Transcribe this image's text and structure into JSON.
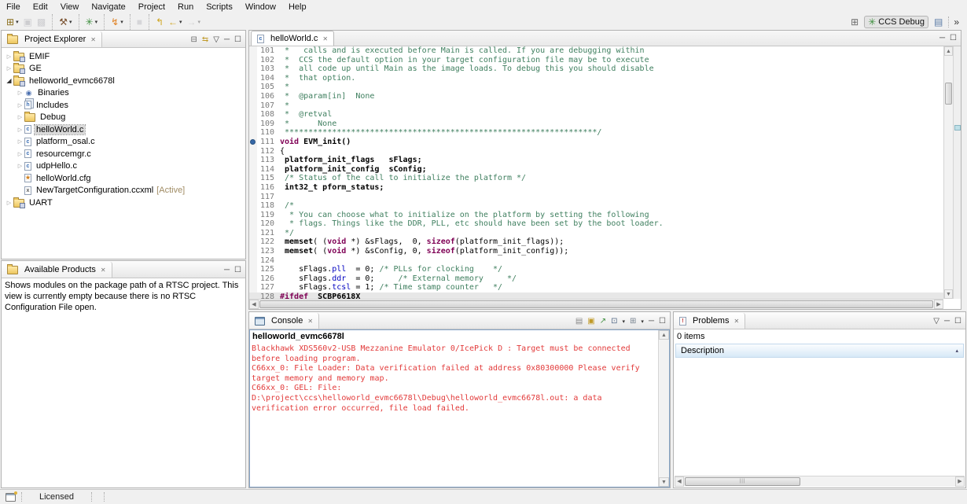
{
  "icons": {
    "close": "✕",
    "view_menu": "▽",
    "minimize": "─",
    "maximize": "☐",
    "scroll_up": "▲",
    "scroll_down": "▼",
    "scroll_left": "◀",
    "scroll_right": "▶",
    "sort_asc": "▴",
    "dropdown": "▾",
    "overflow": "»"
  },
  "menu_bar": {
    "items": [
      "File",
      "Edit",
      "View",
      "Navigate",
      "Project",
      "Run",
      "Scripts",
      "Window",
      "Help"
    ]
  },
  "toolbar": {
    "groups": [
      {
        "buttons": [
          {
            "name": "new",
            "glyph": "⊞",
            "color": "#8a6d1a",
            "dropdown": true
          },
          {
            "name": "save",
            "glyph": "▣",
            "color": "#9a9aa2",
            "disabled": true
          },
          {
            "name": "save-all",
            "glyph": "▩",
            "color": "#9a9aa2",
            "disabled": true
          }
        ]
      },
      {
        "buttons": [
          {
            "name": "build",
            "glyph": "⚒",
            "color": "#7a5230",
            "dropdown": true
          }
        ]
      },
      {
        "buttons": [
          {
            "name": "debug",
            "glyph": "✳",
            "color": "#3f8f3f",
            "dropdown": true
          }
        ]
      },
      {
        "buttons": [
          {
            "name": "flash",
            "glyph": "↯",
            "color": "#e08020",
            "dropdown": true
          }
        ]
      },
      {
        "buttons": [
          {
            "name": "terminate",
            "glyph": "■",
            "color": "#b0b0b8",
            "disabled": true
          }
        ]
      },
      {
        "buttons": [
          {
            "name": "last-edit-location",
            "glyph": "↰",
            "color": "#cfa520"
          },
          {
            "name": "back",
            "glyph": "←",
            "color": "#cfa520",
            "dropdown": true
          },
          {
            "name": "forward",
            "glyph": "→",
            "color": "#a8a8a8",
            "dropdown": true,
            "disabled": true
          }
        ]
      }
    ]
  },
  "perspective_bar": {
    "buttons": [
      {
        "name": "open-perspective",
        "glyph": "⊞",
        "color": "#6b6b6b"
      },
      {
        "name": "ccs-debug-perspective",
        "glyph": "✳",
        "color": "#3f8f3f",
        "label": "CCS Debug",
        "pressed": true
      },
      {
        "name": "ccs-edit-perspective",
        "glyph": "▤",
        "color": "#5a7ba6"
      },
      {
        "name": "perspective-overflow",
        "glyph": "»",
        "color": "#333333",
        "separator_before": true
      }
    ]
  },
  "project_explorer": {
    "title": "Project Explorer",
    "actions": [
      {
        "name": "collapse-all",
        "glyph": "⊟",
        "color": "#666666"
      },
      {
        "name": "link-with-editor",
        "glyph": "⇆",
        "color": "#c09a28"
      },
      {
        "name": "view-menu",
        "glyph": "▽",
        "color": "#444444"
      },
      {
        "name": "minimize",
        "glyph": "─",
        "color": "#444444"
      },
      {
        "name": "maximize",
        "glyph": "☐",
        "color": "#444444"
      }
    ],
    "items": [
      {
        "label": "EMIF",
        "indent": 0,
        "expander": "collapsed",
        "icon": "ccs-project",
        "icon_class": "fi-folder fi-proj"
      },
      {
        "label": "GE",
        "indent": 0,
        "expander": "collapsed",
        "icon": "ccs-project",
        "icon_class": "fi-folder fi-proj"
      },
      {
        "label": "helloworld_evmc6678l",
        "indent": 0,
        "expander": "expanded",
        "icon": "ccs-project-open",
        "icon_class": "fi-folder fi-proj"
      },
      {
        "label": "Binaries",
        "indent": 1,
        "expander": "collapsed",
        "icon": "binaries",
        "icon_class": "fi-glyph",
        "icon_letter": "◉",
        "icon_letter_color": "#4a6faf"
      },
      {
        "label": "Includes",
        "indent": 1,
        "expander": "collapsed",
        "icon": "includes",
        "icon_class": "fi-page fi-inc",
        "icon_letter": "h",
        "icon_letter_color": "#3a6eb5"
      },
      {
        "label": "Debug",
        "indent": 1,
        "expander": "collapsed",
        "icon": "folder",
        "icon_class": "fi-folder"
      },
      {
        "label": "helloWorld.c",
        "indent": 1,
        "expander": "collapsed",
        "icon": "c-file",
        "icon_class": "fi-page",
        "icon_letter": "c",
        "icon_letter_color": "#3a6eb5",
        "selected": true
      },
      {
        "label": "platform_osal.c",
        "indent": 1,
        "expander": "collapsed",
        "icon": "c-file",
        "icon_class": "fi-page",
        "icon_letter": "c",
        "icon_letter_color": "#3a6eb5"
      },
      {
        "label": "resourcemgr.c",
        "indent": 1,
        "expander": "collapsed",
        "icon": "c-file-linked",
        "icon_class": "fi-page",
        "icon_letter": "c",
        "icon_letter_color": "#3a6eb5"
      },
      {
        "label": "udpHello.c",
        "indent": 1,
        "expander": "collapsed",
        "icon": "c-file",
        "icon_class": "fi-page",
        "icon_letter": "c",
        "icon_letter_color": "#3a6eb5"
      },
      {
        "label": "helloWorld.cfg",
        "indent": 1,
        "expander": "none",
        "icon": "rtsc-cfg-file",
        "icon_class": "fi-page",
        "icon_letter": "★",
        "icon_letter_color": "#d08020"
      },
      {
        "label": "NewTargetConfiguration.ccxml",
        "indent": 1,
        "expander": "none",
        "icon": "ccxml-file",
        "icon_class": "fi-page",
        "icon_letter": "x",
        "icon_letter_color": "#555555",
        "suffix": "[Active]"
      },
      {
        "label": "UART",
        "indent": 0,
        "expander": "collapsed",
        "icon": "ccs-project",
        "icon_class": "fi-folder fi-proj"
      }
    ]
  },
  "available_products": {
    "title": "Available Products",
    "message": "Shows modules on the package path of a RTSC project. This view is currently empty because there is no RTSC Configuration File open.",
    "actions": [
      {
        "name": "minimize",
        "glyph": "─",
        "color": "#444444"
      },
      {
        "name": "maximize",
        "glyph": "☐",
        "color": "#444444"
      }
    ]
  },
  "editor": {
    "tab_label": "helloWorld.c",
    "actions": [
      {
        "name": "minimize",
        "glyph": "─",
        "color": "#444444"
      },
      {
        "name": "maximize",
        "glyph": "☐",
        "color": "#444444"
      }
    ],
    "lines": [
      {
        "num": 101,
        "seg": [
          {
            "c": "cm",
            "t": " *   calls and is executed before Main is called. If you are debugging within"
          }
        ]
      },
      {
        "num": 102,
        "seg": [
          {
            "c": "cm",
            "t": " *  CCS the default option in your target configuration file may be to execute"
          }
        ]
      },
      {
        "num": 103,
        "seg": [
          {
            "c": "cm",
            "t": " *  all code up until Main as the image loads. To debug this you should disable"
          }
        ]
      },
      {
        "num": 104,
        "seg": [
          {
            "c": "cm",
            "t": " *  that option."
          }
        ]
      },
      {
        "num": 105,
        "seg": [
          {
            "c": "cm",
            "t": " *"
          }
        ]
      },
      {
        "num": 106,
        "seg": [
          {
            "c": "cm",
            "t": " *  @param[in]  None"
          }
        ]
      },
      {
        "num": 107,
        "seg": [
          {
            "c": "cm",
            "t": " *"
          }
        ]
      },
      {
        "num": 108,
        "seg": [
          {
            "c": "cm",
            "t": " *  @retval"
          }
        ]
      },
      {
        "num": 109,
        "seg": [
          {
            "c": "cm",
            "t": " *      None"
          }
        ]
      },
      {
        "num": 110,
        "seg": [
          {
            "c": "cm",
            "t": " ******************************************************************/"
          }
        ]
      },
      {
        "num": 111,
        "breakpoint": true,
        "seg": [
          {
            "c": "kw",
            "t": "void"
          },
          {
            "c": "fn",
            "t": " EVM_init()"
          }
        ]
      },
      {
        "num": 112,
        "seg": [
          {
            "c": "pl",
            "t": "{"
          }
        ]
      },
      {
        "num": 113,
        "seg": [
          {
            "c": "fn",
            "t": " platform_init_flags   sFlags;"
          }
        ]
      },
      {
        "num": 114,
        "seg": [
          {
            "c": "fn",
            "t": " platform_init_config  sConfig;"
          }
        ]
      },
      {
        "num": 115,
        "seg": [
          {
            "c": "cm",
            "t": " /* Status of the call to initialize the platform */"
          }
        ]
      },
      {
        "num": 116,
        "seg": [
          {
            "c": "fn",
            "t": " int32_t pform_status;"
          }
        ]
      },
      {
        "num": 117,
        "seg": []
      },
      {
        "num": 118,
        "seg": [
          {
            "c": "cm",
            "t": " /*"
          }
        ]
      },
      {
        "num": 119,
        "seg": [
          {
            "c": "cm",
            "t": "  * You can choose what to initialize on the platform by setting the following"
          }
        ]
      },
      {
        "num": 120,
        "seg": [
          {
            "c": "cm",
            "t": "  * flags. Things like the DDR, PLL, etc should have been set by the boot loader."
          }
        ]
      },
      {
        "num": 121,
        "seg": [
          {
            "c": "cm",
            "t": " */"
          }
        ]
      },
      {
        "num": 122,
        "seg": [
          {
            "c": "fn",
            "t": " memset"
          },
          {
            "c": "pl",
            "t": "( ("
          },
          {
            "c": "kw",
            "t": "void"
          },
          {
            "c": "pl",
            "t": " *) &sFlags,  0, "
          },
          {
            "c": "kw",
            "t": "sizeof"
          },
          {
            "c": "pl",
            "t": "(platform_init_flags));"
          }
        ]
      },
      {
        "num": 123,
        "seg": [
          {
            "c": "fn",
            "t": " memset"
          },
          {
            "c": "pl",
            "t": "( ("
          },
          {
            "c": "kw",
            "t": "void"
          },
          {
            "c": "pl",
            "t": " *) &sConfig, 0, "
          },
          {
            "c": "kw",
            "t": "sizeof"
          },
          {
            "c": "pl",
            "t": "(platform_init_config));"
          }
        ]
      },
      {
        "num": 124,
        "seg": []
      },
      {
        "num": 125,
        "seg": [
          {
            "c": "pl",
            "t": "    sFlags."
          },
          {
            "c": "fld",
            "t": "pll"
          },
          {
            "c": "pl",
            "t": "  = 0; "
          },
          {
            "c": "cm",
            "t": "/* PLLs for clocking    */"
          }
        ]
      },
      {
        "num": 126,
        "seg": [
          {
            "c": "pl",
            "t": "    sFlags."
          },
          {
            "c": "fld",
            "t": "ddr"
          },
          {
            "c": "pl",
            "t": "  = 0;     "
          },
          {
            "c": "cm",
            "t": "/* External memory     */"
          }
        ]
      },
      {
        "num": 127,
        "seg": [
          {
            "c": "pl",
            "t": "    sFlags."
          },
          {
            "c": "fld",
            "t": "tcsl"
          },
          {
            "c": "pl",
            "t": " = 1; "
          },
          {
            "c": "cm",
            "t": "/* Time stamp counter   */"
          }
        ]
      },
      {
        "num": 128,
        "inactive": true,
        "seg": [
          {
            "c": "dir",
            "t": "#ifdef"
          },
          {
            "c": "fn",
            "t": "  SCBP6618X"
          }
        ]
      }
    ]
  },
  "console": {
    "title": "Console",
    "program_label": "helloworld_evmc6678l",
    "actions": [
      {
        "name": "clear-console",
        "glyph": "▤",
        "color": "#8a8a8a"
      },
      {
        "name": "scroll-lock",
        "glyph": "▣",
        "color": "#c09a28"
      },
      {
        "name": "pin-console",
        "glyph": "↗",
        "color": "#3f8f3f"
      },
      {
        "name": "display-selected-console",
        "glyph": "⊡",
        "color": "#556b88",
        "dropdown": true
      },
      {
        "name": "open-console",
        "glyph": "⊞",
        "color": "#77838f",
        "dropdown": true
      },
      {
        "name": "minimize",
        "glyph": "─",
        "color": "#444444"
      },
      {
        "name": "maximize",
        "glyph": "☐",
        "color": "#444444"
      }
    ],
    "lines": [
      "Blackhawk XDS560v2-USB Mezzanine Emulator 0/IcePick D : Target must be connected before loading program.",
      "C66xx_0: File Loader: Data verification failed at address 0x80300000 Please verify target memory and memory map.",
      "C66xx_0: GEL: File: D:\\project\\ccs\\helloworld_evmc6678l\\Debug\\helloworld_evmc6678l.out: a data verification error occurred, file load failed."
    ]
  },
  "problems": {
    "title": "Problems",
    "zero_items": "0 items",
    "description_column": "Description",
    "actions": [
      {
        "name": "view-menu",
        "glyph": "▽",
        "color": "#444444"
      },
      {
        "name": "minimize",
        "glyph": "─",
        "color": "#444444"
      },
      {
        "name": "maximize",
        "glyph": "☐",
        "color": "#444444"
      }
    ]
  },
  "status_bar": {
    "licensed_label": "Licensed"
  }
}
